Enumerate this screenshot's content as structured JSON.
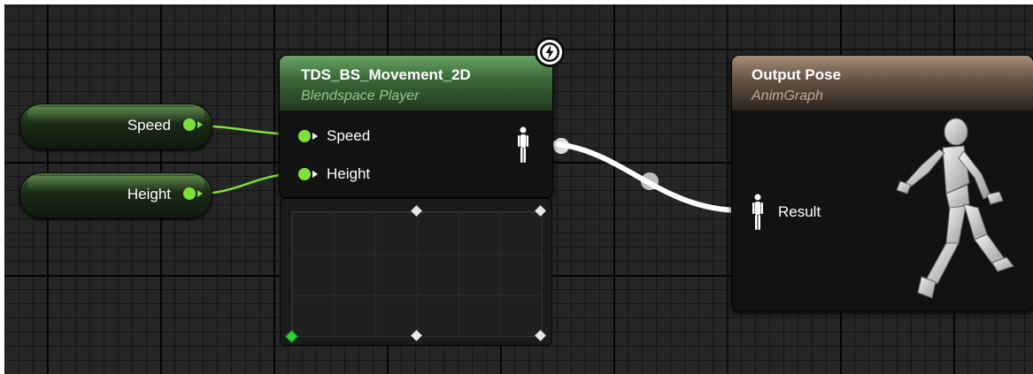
{
  "variables": [
    {
      "name": "Speed"
    },
    {
      "name": "Height"
    }
  ],
  "blendspace_node": {
    "title": "TDS_BS_Movement_2D",
    "subtitle": "Blendspace Player",
    "inputs": [
      "Speed",
      "Height"
    ]
  },
  "output_node": {
    "title": "Output Pose",
    "subtitle": "AnimGraph",
    "input": "Result"
  },
  "icons": {
    "live": "lightning-icon",
    "pose": "pose-person-icon",
    "preview": "running-mannequin-icon"
  },
  "colors": {
    "float_pin": "#7ee13a",
    "blendspace_header": "#4f8a4b",
    "output_header": "#8a7461",
    "pose_wire": "#ffffff"
  }
}
